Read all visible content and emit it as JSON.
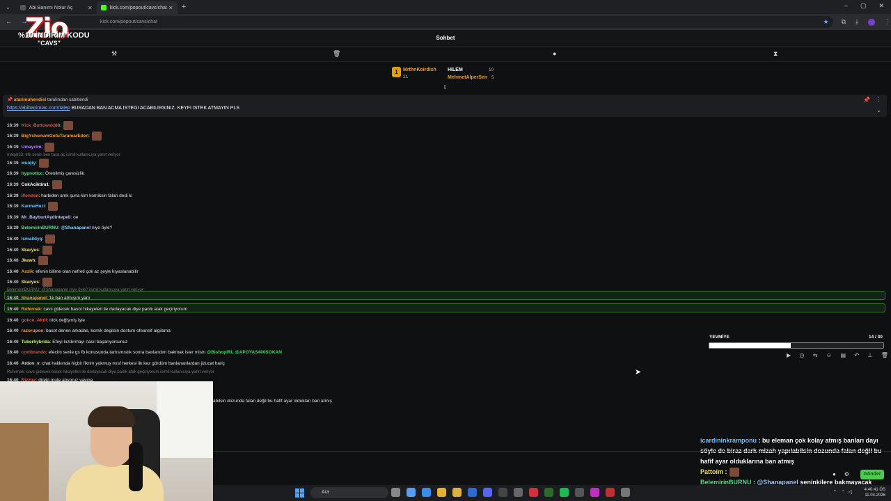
{
  "browser": {
    "tabs": [
      {
        "title": "Abi Banımı Nolur Aç",
        "active": false
      },
      {
        "title": "kick.com/popout/cavs/chat",
        "active": true
      }
    ],
    "url": "kick.com/popout/cavs/chat"
  },
  "promo": {
    "logo": "Zio",
    "line1": "%10 İNDİRİM KODU",
    "line2": "\"CAVS\""
  },
  "chat": {
    "title": "Sohbet",
    "leaderboard": [
      {
        "name": "MrthnKoirdish",
        "value": "21"
      },
      {
        "name": "HILEM",
        "value": "10"
      },
      {
        "name": "MehmetAlperSen",
        "value": "5"
      }
    ],
    "pinned": {
      "author": "atarimuhendisi",
      "suffix": "tarafından sabitlendi",
      "link": "https://abibanimiac.com/talep",
      "text": " BURADAN BAN ACMA ISTEGI ACABILIRSINIZ. KEYFI ISTEK ATMAYIN PLS"
    },
    "messages": [
      {
        "time": "16:39",
        "user": "Kick_Buttowski88",
        "text": ":"
      },
      {
        "time": "16:39",
        "user": "BigYshunumGotuTarumarEden",
        "text": ":"
      },
      {
        "time": "16:39",
        "user": "Umaycim",
        "text": ":"
      },
      {
        "time": "16:39",
        "user": "wuiqty",
        "text": ":"
      },
      {
        "time": "16:39",
        "user": "hypnotlcc",
        "text": ": Örenilmiş çaresizlik"
      },
      {
        "time": "16:39",
        "user": "CokAciktim1",
        "text": ":"
      },
      {
        "time": "16:39",
        "user": "Illonden",
        "text": ": harbiden amk şuna kim komiksin falan dedi ki"
      },
      {
        "time": "16:39",
        "user": "KarmaHuzi",
        "text": ":"
      },
      {
        "time": "16:39",
        "user": "Mr_BayburtAydintepeli",
        "text": ": oe"
      },
      {
        "time": "16:39",
        "user": "BelemirinBURNU",
        "mention": "@Shanapanel",
        "text": " niye öyle?"
      },
      {
        "time": "16:40",
        "user": "Ismaildyg",
        "text": ":"
      },
      {
        "time": "16:40",
        "user": "Skaryus",
        "text": ":"
      },
      {
        "time": "16:40",
        "user": "Jkewh",
        "text": ":"
      },
      {
        "time": "16:40",
        "user": "Axzik",
        "text": ": efenin bilime olan nefreti çok az şeyle kıyaslanabilir"
      },
      {
        "time": "16:40",
        "user": "Skaryus",
        "text": ":"
      },
      {
        "time": "16:40",
        "user": "Shanapanel",
        "text": ": 1k ban atmışım yani"
      },
      {
        "time": "16:40",
        "user": "Rufernak",
        "text": ": cavs gidecek basot hikayeleri ile darlayacak diye panik atak geçiriyorum"
      },
      {
        "time": "16:40",
        "user": "gokce_Aktif",
        "text": ": nick değişmiş işte"
      },
      {
        "time": "16:40",
        "user": "razorupon",
        "text": ": basot denen arkadas, komik degilsin dostum ofeansif algilama"
      },
      {
        "time": "16:40",
        "user": "Tuberhybrida",
        "text": ": Efeyi kızdırmayı nasıl başarıyorsunuz"
      },
      {
        "time": "16:40",
        "user": "conlbrando",
        "text": ": efecim senle gs fb konusunda tartısmıstık sonra banlandım bakmak ister misin ",
        "mention": "@BishopIRL @APOYAS400SOKAN"
      },
      {
        "time": "16:40",
        "user": "Ardov_v",
        "text": ": chat hakkında hiçbir fikrim yokmuş mısf herkesi ilk kez gördüm banlananlardan jizucat hariç"
      },
      {
        "time": "16:40",
        "user": "Rizzler",
        "text": ": direkt mute atıyoruz yayına"
      }
    ],
    "replies": [
      "maqal23: efe senin ben tasa aç isimli kullanıcıya yanıt veriyor",
      "BelemirinBURNU: @Shanapanel niye öyle? isimli kullanıcıya yanıt veriyor",
      "Rufernak: cavs gidecek basot hikayeleri ile darlayacak diye panik atak geçiriyorum isimli kullanıcıya yanıt veriyor"
    ],
    "cut_line": "abilsin dozunda falan değil bu hafif ayar oldukları ban atmış"
  },
  "goal": {
    "label": "YEVMİYE",
    "value": "14 / 30",
    "fraction": 0.467
  },
  "overlay_chat": {
    "line1_name": "icardininkramponu",
    "line1_text": " : bu eleman çok kolay atmış banları dayı söyle de biraz dark mizah yapılabilsin dozunda falan değil bu hafif ayar olduklarına ban atmış",
    "line2_name": "Pattoim",
    "line2_text": " :",
    "line3_name": "BelemirinBURNU",
    "line3_mid": " : ",
    "line3_mention": "@Shanapanel",
    "line3_text": " seninkilere bakmayacak mıyız?"
  },
  "send_label": "Gönder",
  "taskbar": {
    "search": "Ara",
    "time": "4:40:41 ÖS",
    "date": "11.04.2026"
  },
  "colors": {
    "accent": "#53fc18",
    "highlight_border": "#2a7a2a",
    "goal_fill": "#ffffff"
  }
}
